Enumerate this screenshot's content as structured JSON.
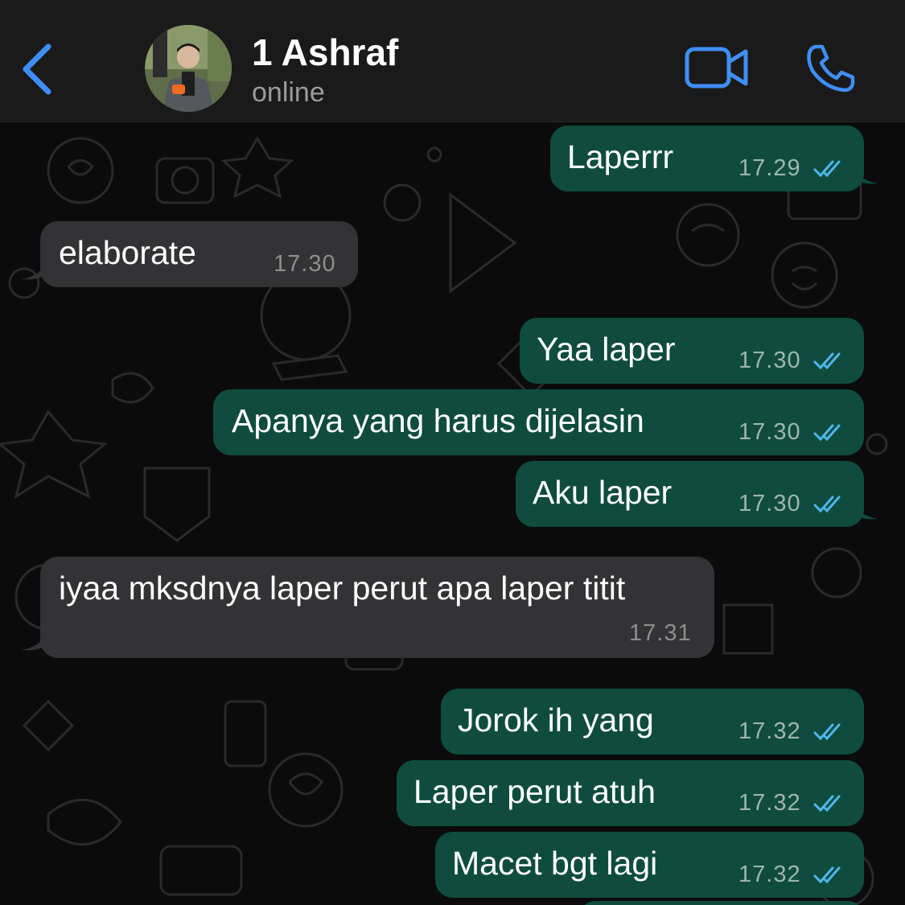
{
  "header": {
    "back_icon": "chevron-left-icon",
    "contact_name": "1 Ashraf",
    "status": "online",
    "video_icon": "video-camera-icon",
    "call_icon": "phone-icon"
  },
  "colors": {
    "accent": "#3f8ef5",
    "outgoing_bubble": "#0f4c3d",
    "incoming_bubble": "#333336",
    "read_ticks": "#4fb6ec",
    "background": "#0b0b0b"
  },
  "messages": [
    {
      "direction": "outgoing",
      "text": "Laperrr",
      "time": "17.29",
      "status": "read"
    },
    {
      "direction": "incoming",
      "text": "elaborate",
      "time": "17.30"
    },
    {
      "direction": "outgoing",
      "text": "Yaa laper",
      "time": "17.30",
      "status": "read"
    },
    {
      "direction": "outgoing",
      "text": "Apanya yang harus dijelasin",
      "time": "17.30",
      "status": "read"
    },
    {
      "direction": "outgoing",
      "text": "Aku laper",
      "time": "17.30",
      "status": "read"
    },
    {
      "direction": "incoming",
      "text": "iyaa mksdnya laper perut apa laper titit",
      "time": "17.31"
    },
    {
      "direction": "outgoing",
      "text": "Jorok ih yang",
      "time": "17.32",
      "status": "read"
    },
    {
      "direction": "outgoing",
      "text": "Laper perut atuh",
      "time": "17.32",
      "status": "read"
    },
    {
      "direction": "outgoing",
      "text": "Macet bgt lagi",
      "time": "17.32",
      "status": "read"
    }
  ]
}
